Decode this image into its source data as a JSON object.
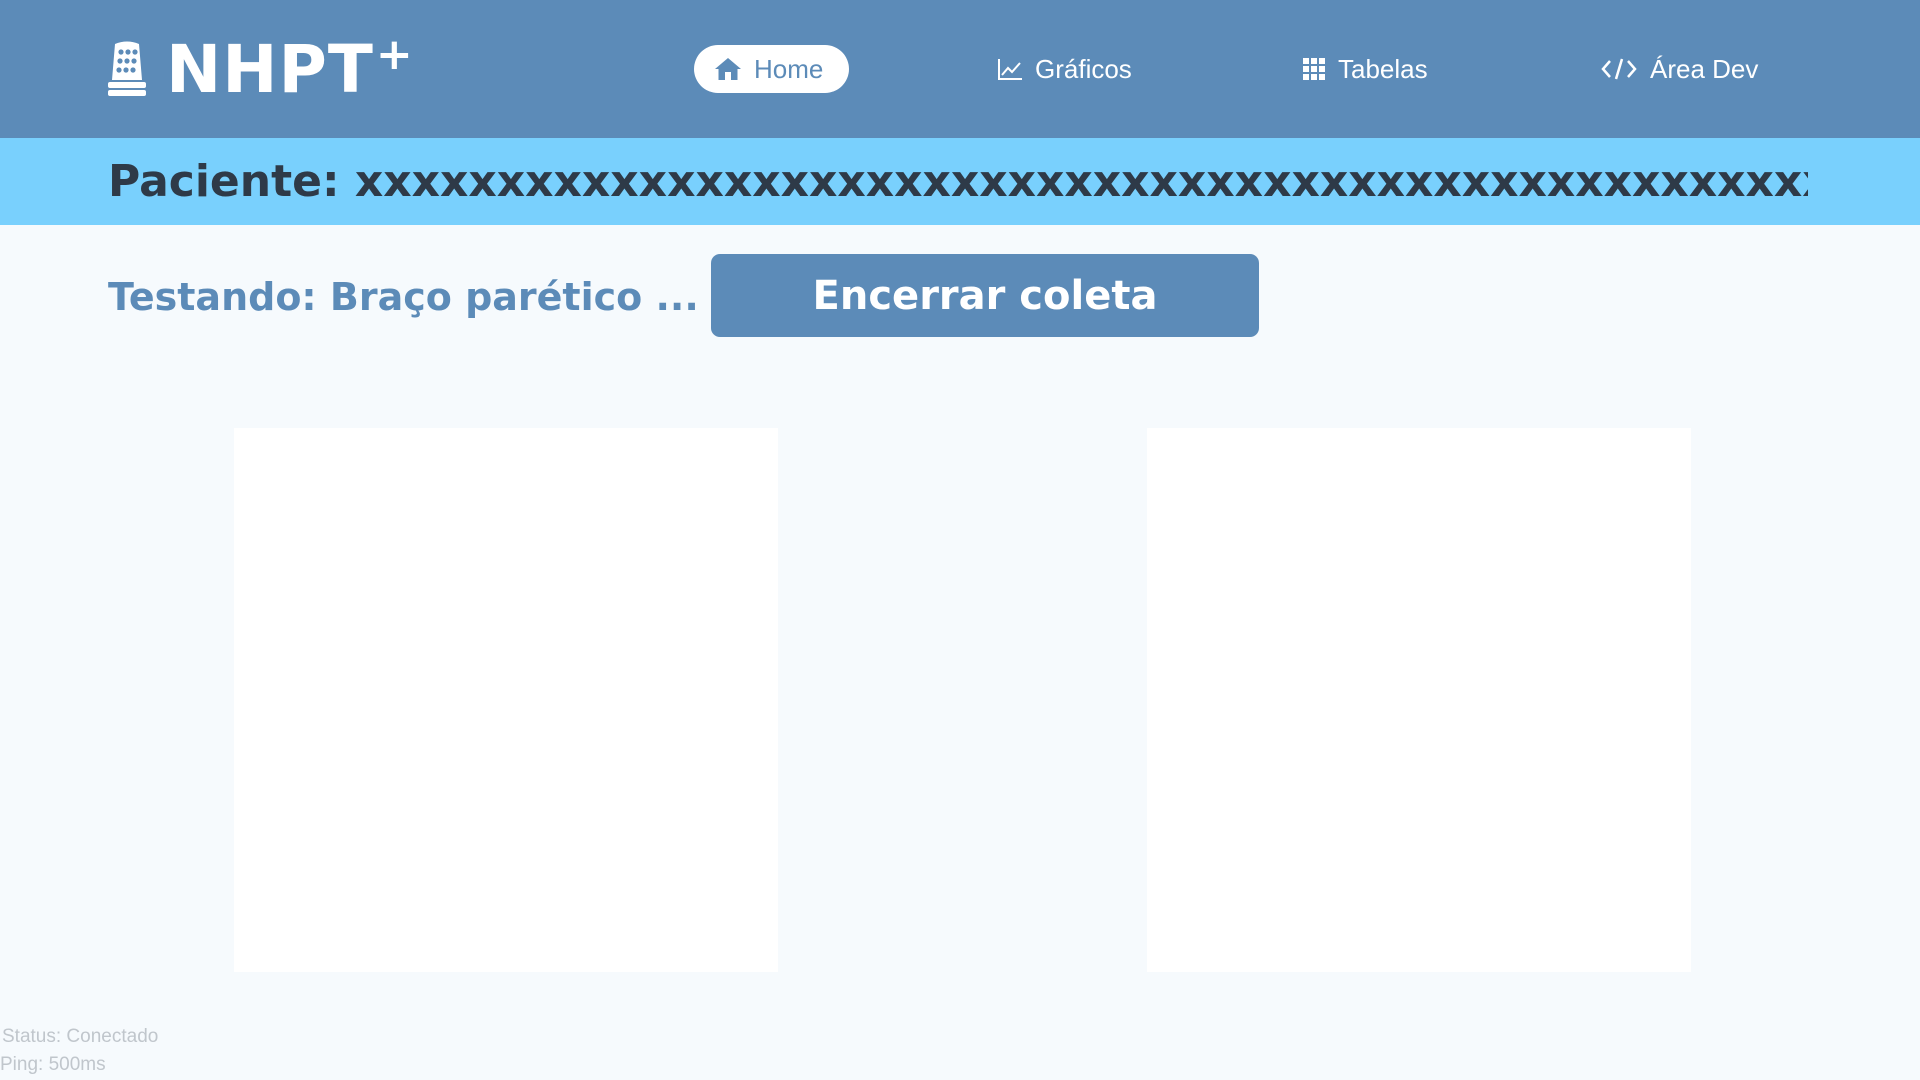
{
  "header": {
    "logo_text": "NHPT",
    "logo_plus": "+",
    "nav": [
      {
        "label": "Home",
        "icon": "home-icon",
        "active": true
      },
      {
        "label": "Gráficos",
        "icon": "chart-line-icon",
        "active": false
      },
      {
        "label": "Tabelas",
        "icon": "table-grid-icon",
        "active": false
      },
      {
        "label": "Área Dev",
        "icon": "code-icon",
        "active": false
      }
    ]
  },
  "patient": {
    "label": "Paciente: xxxxxxxxxxxxxxxxxxxxxxxxxxxxxxxxxxxxxxxxxxxxxxxxxxxxxxx"
  },
  "session": {
    "testing_label": "Testando: Braço parético ...",
    "end_button": "Encerrar coleta"
  },
  "footer": {
    "status": "Status: Conectado",
    "ping": "Ping: 500ms"
  },
  "colors": {
    "header": "#5c8bb8",
    "patient_bar": "#79d0fd",
    "background": "#f6fafd",
    "text_dark": "#2e3a48"
  }
}
